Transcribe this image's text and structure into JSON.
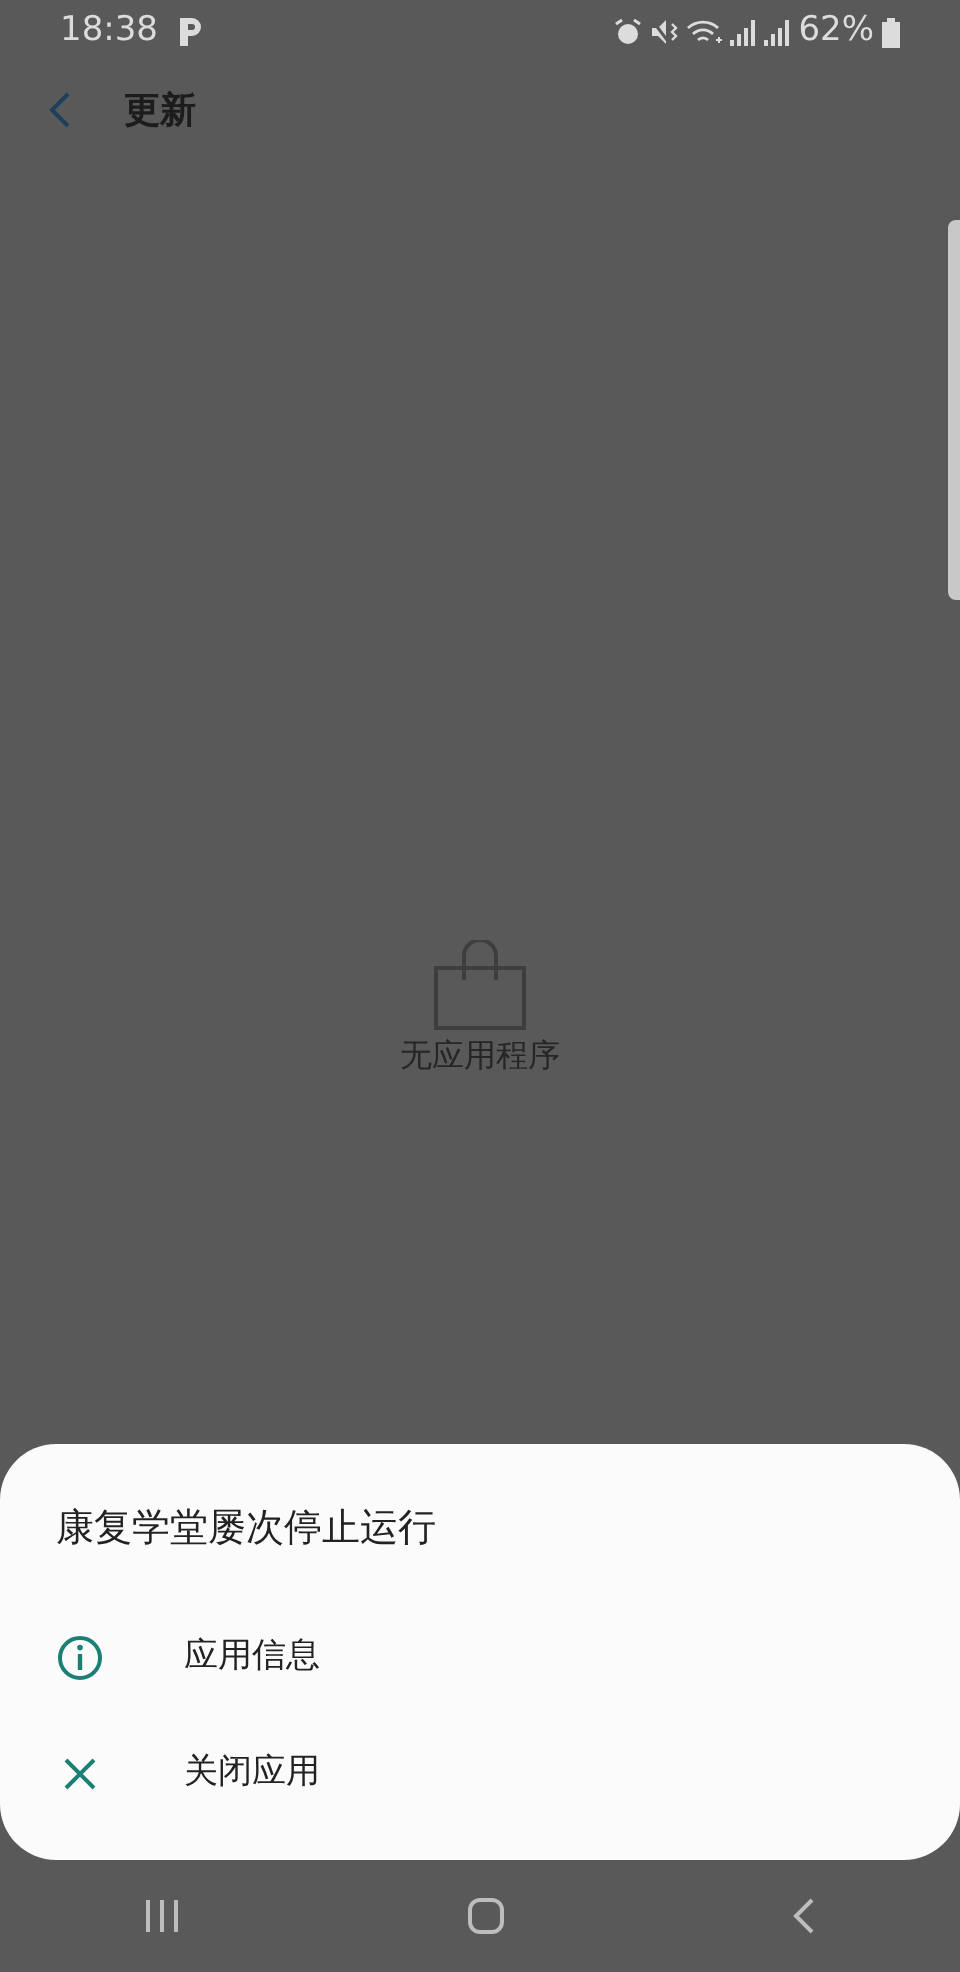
{
  "status_bar": {
    "time": "18:38",
    "battery": "62%"
  },
  "header": {
    "title": "更新"
  },
  "empty_state": {
    "message": "无应用程序"
  },
  "dialog": {
    "title": "康复学堂屡次停止运行",
    "actions": [
      {
        "kind": "info",
        "label": "应用信息"
      },
      {
        "kind": "close",
        "label": "关闭应用"
      }
    ]
  }
}
